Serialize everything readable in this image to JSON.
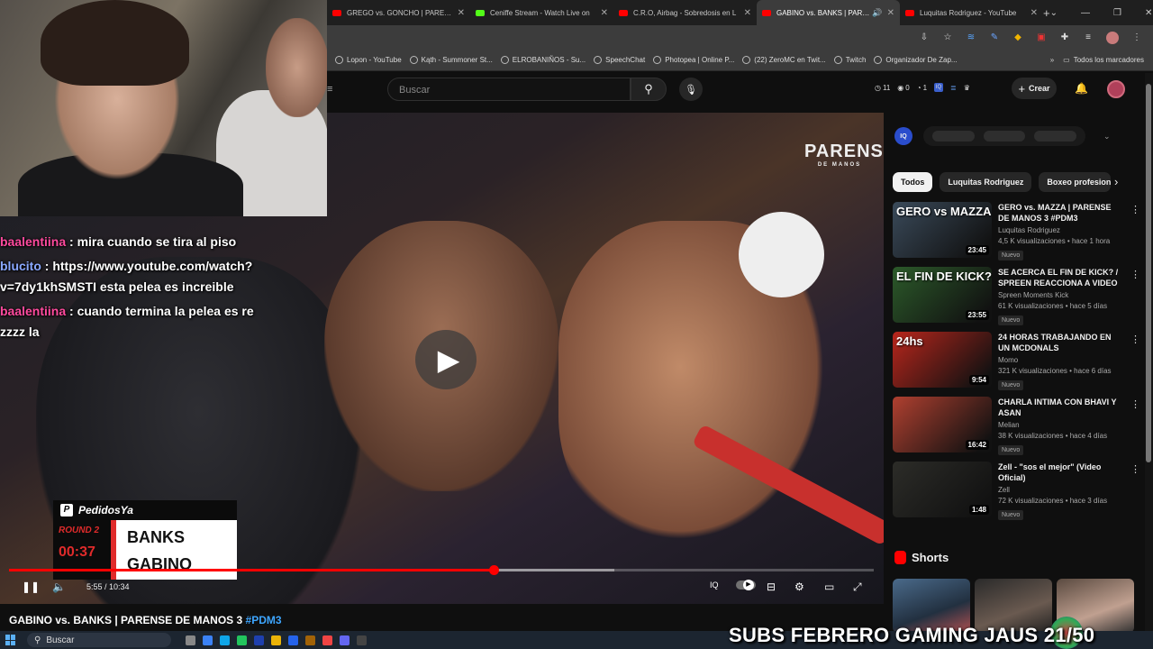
{
  "browser": {
    "tabs": [
      {
        "title": "GREGO vs. GONCHO | PARENSE",
        "color": "#ff0000",
        "active": false
      },
      {
        "title": "Ceniffe Stream - Watch Live on",
        "color": "#53fc18",
        "active": false
      },
      {
        "title": "C.R.O, Airbag - Sobredosis en L",
        "color": "#ff0000",
        "active": false
      },
      {
        "title": "GABINO vs. BANKS | PAREN",
        "color": "#ff0000",
        "active": true
      },
      {
        "title": "Luquitas Rodriguez - YouTube",
        "color": "#ff0000",
        "active": false
      }
    ],
    "new_tab": "+",
    "bookmarks": [
      "Lopon - YouTube",
      "Kąth - Summoner St...",
      "ELROBANIÑOS - Su...",
      "SpeechChat",
      "Photopea | Online P...",
      "(22) ZeroMC en Twit...",
      "Twitch",
      "Organizador De Zap..."
    ],
    "bookmarks_more": "»",
    "all_bookmarks": "Todos los marcadores"
  },
  "youtube": {
    "search_placeholder": "Buscar",
    "ext_counts": [
      "11",
      "0",
      "1"
    ],
    "create_label": "Crear",
    "create_plus": "+"
  },
  "player": {
    "current_time": "5:55",
    "duration": "10:34",
    "time_text": "5:55 / 10:34",
    "progress": 0.56,
    "buffered": 0.7,
    "overlay_logo": "PARENSE",
    "overlay_logo_sub": "DE MANOS"
  },
  "scoreboard": {
    "sponsor": "PedidosYa",
    "round": "ROUND 2",
    "clock": "00:37",
    "fighter1": "BANKS",
    "fighter2": "GABINO"
  },
  "chat": {
    "line0": "",
    "messages": [
      {
        "user": "baalentiina",
        "text": " : mira cuando se tira al piso"
      },
      {
        "user": "blucito",
        "text": " : https://www.youtube.com/watch?v=7dy1khSMSTI esta pelea es increible"
      },
      {
        "user": "baalentiina",
        "text": " : cuando termina la pelea es re zzzz la"
      }
    ]
  },
  "sidebar": {
    "chips": [
      "Todos",
      "Luquitas Rodriguez",
      "Boxeo profesional"
    ],
    "videos": [
      {
        "title": "GERO vs. MAZZA | PARENSE DE MANOS 3 #PDM3",
        "channel": "Luquitas Rodriguez",
        "meta": "4,5 K visualizaciones • hace 1 hora",
        "badge": "Nuevo",
        "duration": "23:45",
        "thumb_text": "GERO vs MAZZA",
        "thumb_bg": "#3a4a5a"
      },
      {
        "title": "SE ACERCA EL FIN DE KICK? / SPREEN REACCIONA A VIDEO ...",
        "channel": "Spreen Moments Kick",
        "meta": "61 K visualizaciones • hace 5 días",
        "badge": "Nuevo",
        "duration": "23:55",
        "thumb_text": "EL FIN DE KICK?",
        "thumb_bg": "#2c5a2a"
      },
      {
        "title": "24 HORAS TRABAJANDO EN UN MCDONALS",
        "channel": "Momo",
        "meta": "321 K visualizaciones • hace 6 días",
        "badge": "Nuevo",
        "duration": "9:54",
        "thumb_text": "24hs",
        "thumb_bg": "#b8261c"
      },
      {
        "title": "CHARLA INTIMA CON BHAVI Y ASAN",
        "channel": "Melian",
        "meta": "38 K visualizaciones • hace 4 días",
        "badge": "Nuevo",
        "duration": "16:42",
        "thumb_text": "",
        "thumb_bg": "#b04030"
      },
      {
        "title": "Zell - \"sos el mejor\" (Video Oficial)",
        "channel": "Zell",
        "meta": "72 K visualizaciones • hace 3 días",
        "badge": "Nuevo",
        "duration": "1:48",
        "thumb_text": "",
        "thumb_bg": "#2c2c28"
      }
    ],
    "shorts_label": "Shorts"
  },
  "video_title": {
    "text": "GABINO vs. BANKS | PARENSE DE MANOS 3",
    "hashtag": "#PDM3"
  },
  "taskbar": {
    "search_label": "Buscar"
  },
  "stream_overlay": {
    "subs_text": "SUBS FEBRERO GAMING JAUS",
    "subs_count": "21/50"
  },
  "colors": {
    "yt_red": "#ff0000",
    "accent_blue": "#3ea6ff",
    "chat_user_pink": "#ff4a9e",
    "chat_user_blue": "#8aa8ff"
  }
}
